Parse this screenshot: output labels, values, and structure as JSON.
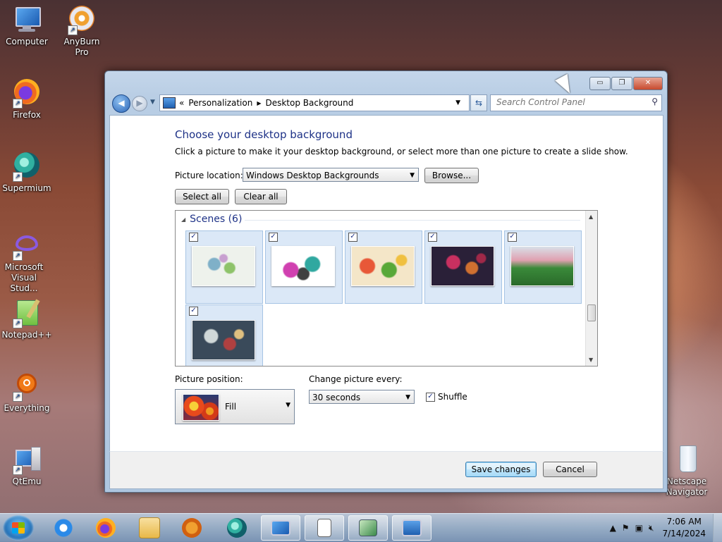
{
  "desktop": {
    "icons": [
      {
        "label": "Computer"
      },
      {
        "label": "AnyBurn Pro"
      },
      {
        "label": "Firefox"
      },
      {
        "label": "Supermium"
      },
      {
        "label": "Microsoft Visual Stud..."
      },
      {
        "label": "Notepad++"
      },
      {
        "label": "Everything"
      },
      {
        "label": "QtEmu"
      },
      {
        "label": "Netscape Navigator"
      }
    ]
  },
  "window": {
    "controls": {
      "minimize": "▭",
      "maximize": "❐",
      "close": "✕"
    },
    "nav": {
      "back": "◀",
      "forward": "▶"
    },
    "address": {
      "prefix": "«",
      "crumb1": "Personalization",
      "sep": "▶",
      "crumb2": "Desktop Background"
    },
    "search_placeholder": "Search Control Panel",
    "title": "Choose your desktop background",
    "subtitle": "Click a picture to make it your desktop background, or select more than one picture to create a slide show.",
    "picture_location_label": "Picture location:",
    "picture_location_value": "Windows Desktop Backgrounds",
    "browse_label": "Browse...",
    "select_all_label": "Select all",
    "clear_all_label": "Clear all",
    "group": {
      "label": "Scenes (6)"
    },
    "thumbnails": [
      {
        "checked": true,
        "colors": [
          "#eef2ec",
          "#7fb0c8",
          "#8ec36a"
        ]
      },
      {
        "checked": true,
        "colors": [
          "#ffffff",
          "#d040b0",
          "#30a8a0"
        ]
      },
      {
        "checked": true,
        "colors": [
          "#f4e6c8",
          "#e85838",
          "#58a838"
        ]
      },
      {
        "checked": true,
        "colors": [
          "#2a2038",
          "#c83060",
          "#d07030"
        ]
      },
      {
        "checked": true,
        "colors": [
          "#d8e0e8",
          "#3a8a3a",
          "#e0a0b0"
        ]
      },
      {
        "checked": true,
        "colors": [
          "#3a4a5a",
          "#d0d8d8",
          "#b04040"
        ]
      }
    ],
    "picture_position_label": "Picture position:",
    "picture_position_value": "Fill",
    "change_every_label": "Change picture every:",
    "change_every_value": "30 seconds",
    "shuffle_label": "Shuffle",
    "shuffle_checked": true,
    "save_label": "Save changes",
    "cancel_label": "Cancel"
  },
  "taskbar": {
    "time": "7:06 AM",
    "date": "7/14/2024"
  }
}
